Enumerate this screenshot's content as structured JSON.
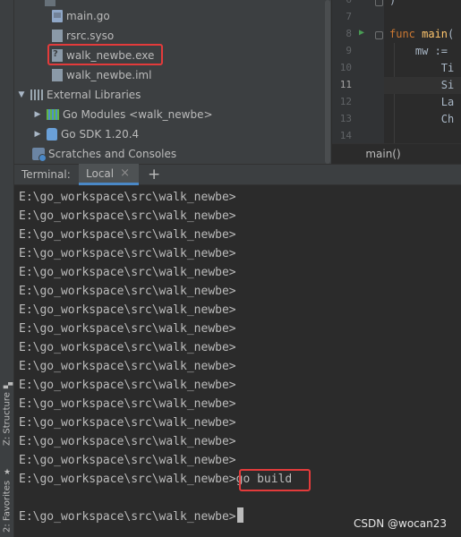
{
  "project_tree": {
    "files": [
      {
        "name": "main.go",
        "icon": "go-file-icon"
      },
      {
        "name": "rsrc.syso",
        "icon": "syso-file-icon"
      },
      {
        "name": "walk_newbe.exe",
        "icon": "exe-file-icon"
      },
      {
        "name": "walk_newbe.iml",
        "icon": "iml-file-icon"
      }
    ],
    "external_libraries": {
      "label": "External Libraries",
      "icon": "library-icon"
    },
    "libraries": [
      {
        "label": "Go Modules <walk_newbe>",
        "icon": "go-modules-icon"
      },
      {
        "label": "Go SDK 1.20.4",
        "icon": "go-sdk-icon"
      }
    ],
    "scratches": {
      "label": "Scratches and Consoles",
      "icon": "scratches-icon"
    }
  },
  "editor": {
    "lines": [
      {
        "num": "6",
        "parts": [
          {
            "t": ")",
            "c": "tx"
          }
        ]
      },
      {
        "num": "7",
        "parts": []
      },
      {
        "num": "8",
        "parts": [
          {
            "t": "func ",
            "c": "kw"
          },
          {
            "t": "main",
            "c": "fn"
          },
          {
            "t": "(",
            "c": "tx"
          }
        ]
      },
      {
        "num": "9",
        "parts": [
          {
            "t": "    mw := ",
            "c": "tx"
          }
        ]
      },
      {
        "num": "10",
        "parts": [
          {
            "t": "        Ti",
            "c": "tx"
          }
        ]
      },
      {
        "num": "11",
        "parts": [
          {
            "t": "        Si",
            "c": "tx"
          }
        ]
      },
      {
        "num": "12",
        "parts": [
          {
            "t": "        La",
            "c": "tx"
          }
        ]
      },
      {
        "num": "13",
        "parts": [
          {
            "t": "        Ch",
            "c": "tx"
          }
        ]
      },
      {
        "num": "14",
        "parts": []
      }
    ],
    "current_line": "11",
    "breadcrumb": "main()"
  },
  "terminal": {
    "label": "Terminal:",
    "tab": "Local",
    "lines": [
      "E:\\go_workspace\\src\\walk_newbe>",
      "E:\\go_workspace\\src\\walk_newbe>",
      "E:\\go_workspace\\src\\walk_newbe>",
      "E:\\go_workspace\\src\\walk_newbe>",
      "E:\\go_workspace\\src\\walk_newbe>",
      "E:\\go_workspace\\src\\walk_newbe>",
      "E:\\go_workspace\\src\\walk_newbe>",
      "E:\\go_workspace\\src\\walk_newbe>",
      "E:\\go_workspace\\src\\walk_newbe>",
      "E:\\go_workspace\\src\\walk_newbe>",
      "E:\\go_workspace\\src\\walk_newbe>",
      "E:\\go_workspace\\src\\walk_newbe>",
      "E:\\go_workspace\\src\\walk_newbe>",
      "E:\\go_workspace\\src\\walk_newbe>",
      "E:\\go_workspace\\src\\walk_newbe>",
      "E:\\go_workspace\\src\\walk_newbe>go build",
      "",
      "E:\\go_workspace\\src\\walk_newbe>"
    ]
  },
  "side_tabs": {
    "structure": "Z: Structure",
    "favorites": "2: Favorites"
  },
  "watermark": "CSDN @wocan23",
  "colors": {
    "highlight": "#e33b3b",
    "accent": "#4a88c7"
  }
}
